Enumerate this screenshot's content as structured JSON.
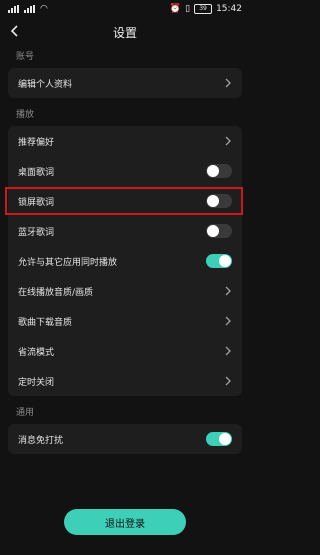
{
  "status_bar": {
    "time": "15:42",
    "battery": "39"
  },
  "header": {
    "title": "设置",
    "back_icon": "chevron-left-icon"
  },
  "sections": {
    "account": {
      "label": "账号",
      "items": [
        {
          "label": "编辑个人资料",
          "control": "chevron"
        }
      ]
    },
    "playback": {
      "label": "播放",
      "items": [
        {
          "label": "推荐偏好",
          "control": "chevron"
        },
        {
          "label": "桌面歌词",
          "control": "toggle",
          "on": false
        },
        {
          "label": "锁屏歌词",
          "control": "toggle",
          "on": false
        },
        {
          "label": "蓝牙歌词",
          "control": "toggle",
          "on": false
        },
        {
          "label": "允许与其它应用同时播放",
          "control": "toggle",
          "on": true
        },
        {
          "label": "在线播放音质/画质",
          "control": "chevron"
        },
        {
          "label": "歌曲下载音质",
          "control": "chevron"
        },
        {
          "label": "省流模式",
          "control": "chevron"
        },
        {
          "label": "定时关闭",
          "control": "chevron"
        }
      ]
    },
    "general": {
      "label": "通用",
      "items": [
        {
          "label": "消息免打扰",
          "control": "toggle",
          "on": true
        }
      ]
    }
  },
  "logout": {
    "label": "退出登录"
  },
  "colors": {
    "accent": "#3ecfb8",
    "highlight": "#d01818",
    "background": "#121212",
    "card": "#1e1e1e"
  }
}
